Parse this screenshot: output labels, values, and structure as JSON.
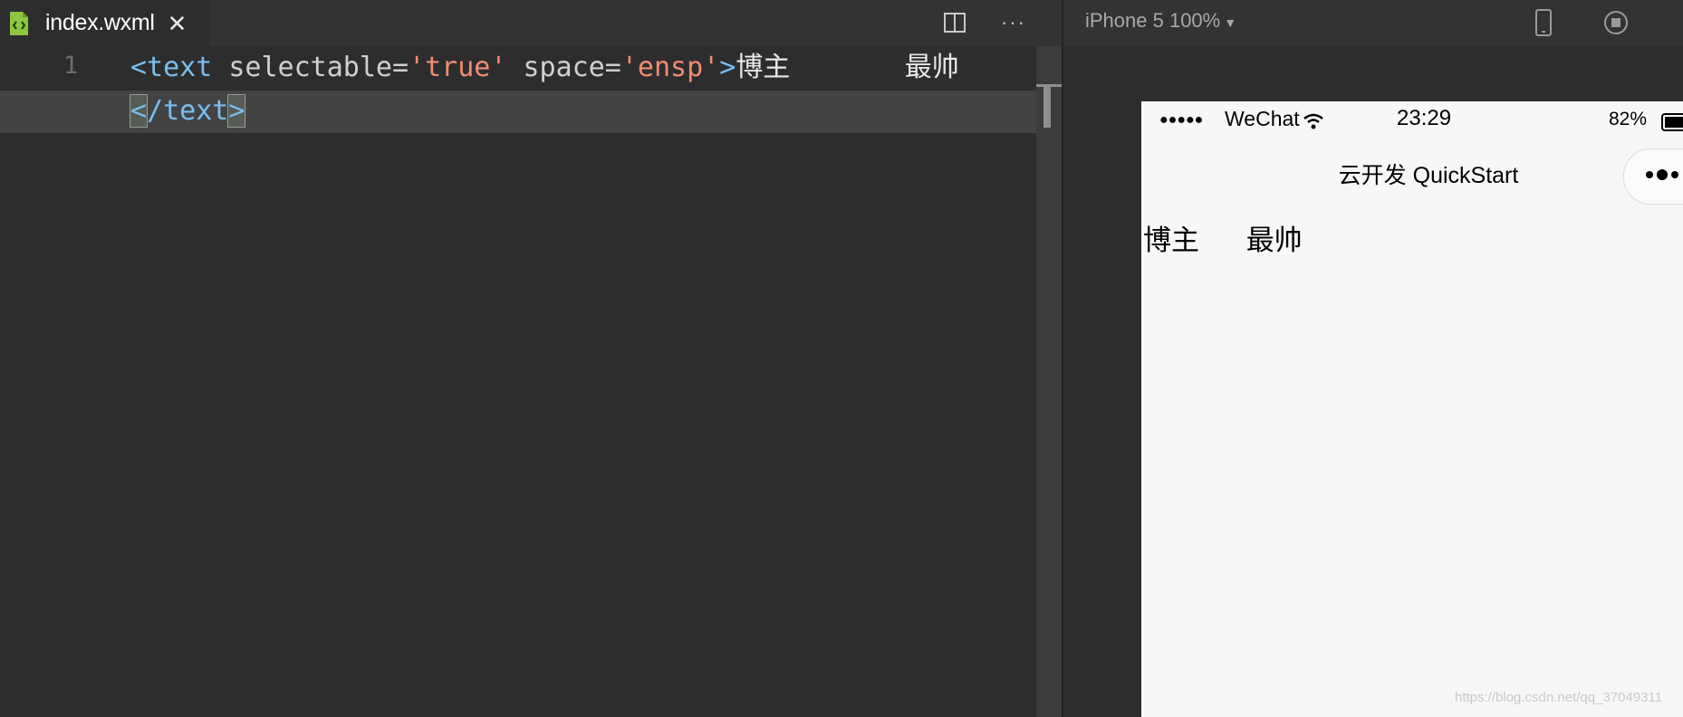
{
  "editor": {
    "tab": {
      "title": "index.wxml",
      "close": "✕"
    },
    "split_icon": "split-editor-icon",
    "more_label": "···",
    "line_numbers": [
      "1"
    ],
    "code": {
      "open_tag": "<text",
      "attr1_name": " selectable=",
      "attr1_value": "'true'",
      "attr2_name": " space=",
      "attr2_value": "'ensp'",
      "tag_close": ">",
      "content_a": "博主",
      "content_gap": "       ",
      "content_b": "最帅",
      "close_lt": "<",
      "close_mid": "/text",
      "close_gt": ">"
    }
  },
  "simulator": {
    "device_label": "iPhone 5 100%",
    "device_caret": "▼",
    "icons": [
      "phone-device-icon",
      "stop-record-icon"
    ],
    "status_bar": {
      "signal": "●●●●●",
      "carrier": "WeChat",
      "time": "23:29",
      "battery_percent": "82%"
    },
    "nav_title": "云开发 QuickStart",
    "capsule_more": "•●•",
    "page_text_a": "博主",
    "page_text_gap": "      ",
    "page_text_b": "最帅"
  },
  "watermark": "https://blog.csdn.net/qq_37049311",
  "colors": {
    "editor_bg": "#2d2d2d",
    "current_line": "#434343",
    "tag": "#79bff0",
    "string": "#f08c72",
    "phone_bg": "#f7f7f7"
  }
}
